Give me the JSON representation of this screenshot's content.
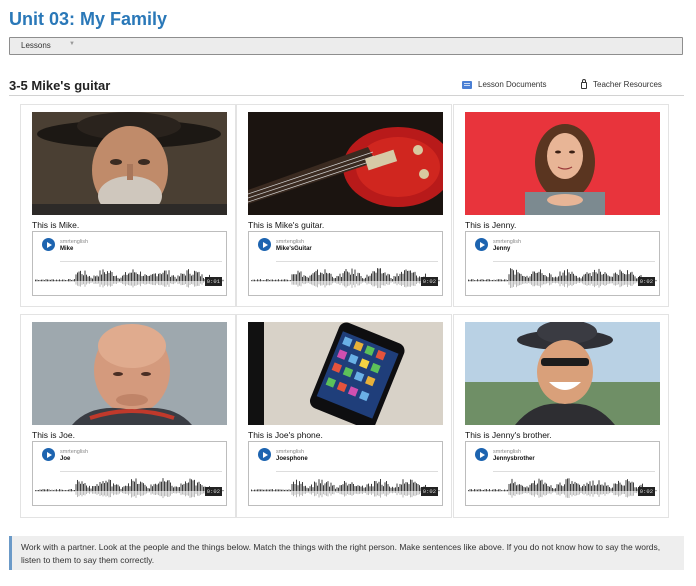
{
  "page": {
    "unit_title": "Unit 03: My Family"
  },
  "nav": {
    "lessons_label": "Lessons",
    "caret": "▼"
  },
  "lesson": {
    "title": "3-5 Mike's guitar",
    "links": [
      {
        "label": "Lesson Documents",
        "icon": "document-icon"
      },
      {
        "label": "Teacher Resources",
        "icon": "lock-icon"
      }
    ]
  },
  "cards": [
    {
      "caption": "This is Mike.",
      "player": {
        "user": "smrtenglish",
        "track": "Mike",
        "time": "0:01"
      },
      "photo": "man-with-cowboy-hat"
    },
    {
      "caption": "This is Mike's guitar.",
      "player": {
        "user": "smrtenglish",
        "track": "Mike'sGuitar",
        "time": "0:02"
      },
      "photo": "red-electric-guitar"
    },
    {
      "caption": "This is Jenny.",
      "player": {
        "user": "smrtenglish",
        "track": "Jenny",
        "time": "0:02"
      },
      "photo": "woman-red-background"
    },
    {
      "caption": "This is Joe.",
      "player": {
        "user": "smrtenglish",
        "track": "Joe",
        "time": "0:02"
      },
      "photo": "bald-man"
    },
    {
      "caption": "This is Joe's phone.",
      "player": {
        "user": "smrtenglish",
        "track": "Joesphone",
        "time": "0:02"
      },
      "photo": "smartphone"
    },
    {
      "caption": "This is Jenny's brother.",
      "player": {
        "user": "smrtenglish",
        "track": "Jennysbrother",
        "time": "0:02"
      },
      "photo": "man-with-hat-laughing"
    }
  ],
  "instructions": "Work with a partner. Look at the people and the things below. Match the things with the right person. Make sentences like above. If you do not know how to say the words, listen to them to say them correctly.",
  "colors": {
    "title_blue": "#2a78b8",
    "play_blue": "#1d64b0",
    "jenny_bg": "#e8343c"
  }
}
